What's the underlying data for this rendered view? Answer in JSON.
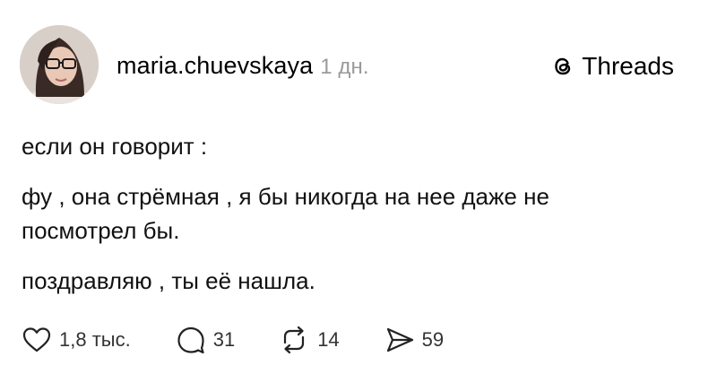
{
  "header": {
    "username": "maria.chuevskaya",
    "time": "1 дн.",
    "brand": "Threads"
  },
  "post": {
    "line1": "если он говорит :",
    "line2": "фу , она стрёмная , я бы никогда на нее даже не посмотрел бы.",
    "line3": "поздравляю , ты её нашла."
  },
  "actions": {
    "likes": "1,8 тыс.",
    "replies": "31",
    "reposts": "14",
    "shares": "59"
  },
  "icons": {
    "like": "heart-icon",
    "reply": "comment-bubble-icon",
    "repost": "repost-arrows-icon",
    "share": "send-icon",
    "brand": "threads-logo-icon"
  }
}
